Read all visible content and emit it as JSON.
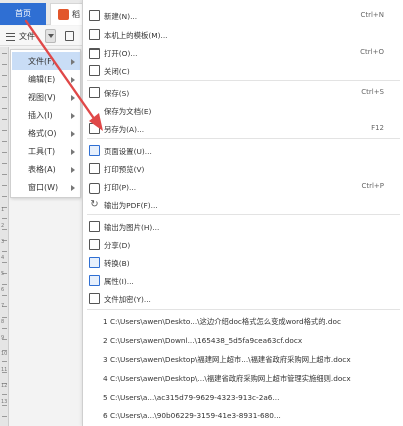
{
  "tabs": {
    "home": "首页",
    "doc_tab_short": "稻"
  },
  "toolbar": {
    "file_label": "文件"
  },
  "ruler_numbers": [
    "1",
    "2",
    "3",
    "4",
    "5",
    "6",
    "7",
    "8",
    "9",
    "10",
    "11",
    "12",
    "13"
  ],
  "submenu": {
    "items": [
      {
        "label": "文件(F)",
        "active": true
      },
      {
        "label": "编辑(E)"
      },
      {
        "label": "视图(V)"
      },
      {
        "label": "插入(I)"
      },
      {
        "label": "格式(O)"
      },
      {
        "label": "工具(T)"
      },
      {
        "label": "表格(A)"
      },
      {
        "label": "窗口(W)"
      }
    ]
  },
  "menu": {
    "items": [
      {
        "label": "新建(N)...",
        "shortcut": "Ctrl+N",
        "icon": "new-doc-icon"
      },
      {
        "label": "本机上的模板(M)...",
        "shortcut": "",
        "icon": "template-icon"
      },
      {
        "label": "打开(O)...",
        "shortcut": "Ctrl+O",
        "icon": "open-folder-icon"
      },
      {
        "label": "关闭(C)",
        "shortcut": "",
        "icon": "close-doc-icon"
      },
      {
        "label": "保存(S)",
        "shortcut": "Ctrl+S",
        "icon": "save-icon"
      },
      {
        "label": "保存为文档(E)",
        "shortcut": "",
        "icon": "save-doc-icon"
      },
      {
        "label": "另存为(A)...",
        "shortcut": "F12",
        "icon": "save-as-icon"
      },
      {
        "label": "页面设置(U)...",
        "shortcut": "",
        "icon": "page-setup-icon"
      },
      {
        "label": "打印预览(V)",
        "shortcut": "",
        "icon": "print-preview-icon"
      },
      {
        "label": "打印(P)...",
        "shortcut": "Ctrl+P",
        "icon": "printer-icon"
      },
      {
        "label": "输出为PDF(F)...",
        "shortcut": "",
        "icon": "pdf-icon"
      },
      {
        "label": "输出为图片(H)...",
        "shortcut": "",
        "icon": "image-icon"
      },
      {
        "label": "分享(D)",
        "shortcut": "",
        "icon": "share-icon"
      },
      {
        "label": "转换(B)",
        "shortcut": "",
        "icon": "convert-icon"
      },
      {
        "label": "属性(I)...",
        "shortcut": "",
        "icon": "properties-icon"
      },
      {
        "label": "文件加密(Y)...",
        "shortcut": "",
        "icon": "encrypt-icon"
      }
    ],
    "recent": [
      "1 C:\\Users\\awen\\Deskto...\\这边介绍doc格式怎么变成word格式的.doc",
      "2 C:\\Users\\awen\\Downl...\\165438_5d5fa9cea63cf.docx",
      "3 C:\\Users\\awen\\Desktop\\福建网上超市...\\福建省政府采购网上超市.docx",
      "4 C:\\Users\\awen\\Desktop\\...\\福建省政府采购网上超市管理实施细则.docx",
      "5 C:\\Users\\a...\\ac315d79-9629-4323-913c-2a6...",
      "6 C:\\Users\\a...\\90b06229-3159-41e3-8931-680..."
    ]
  },
  "colors": {
    "accent": "#2f6fd3",
    "annotation_arrow": "#e04848",
    "active_bg": "#c9ddf6"
  }
}
